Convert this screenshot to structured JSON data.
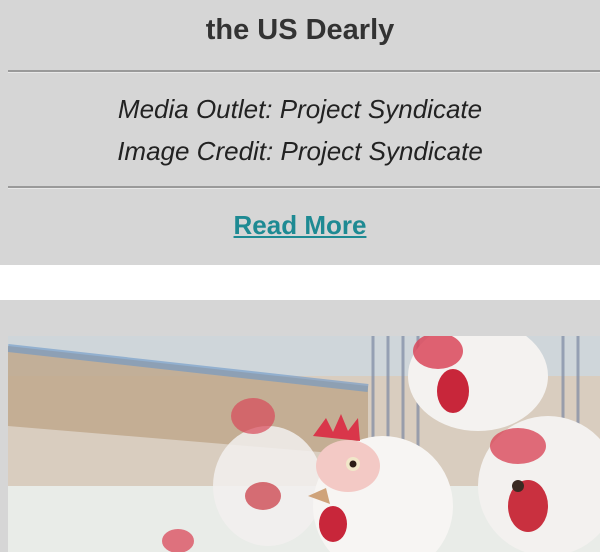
{
  "article": {
    "title_tail": "the US Dearly",
    "media_outlet": "Media Outlet: Project Syndicate",
    "image_credit": "Image Credit: Project Syndicate",
    "read_more": "Read More"
  },
  "next_article": {
    "image_subject": "chickens-photo"
  },
  "colors": {
    "card_bg": "#d6d6d6",
    "link": "#1e8a93",
    "title": "#333333"
  }
}
